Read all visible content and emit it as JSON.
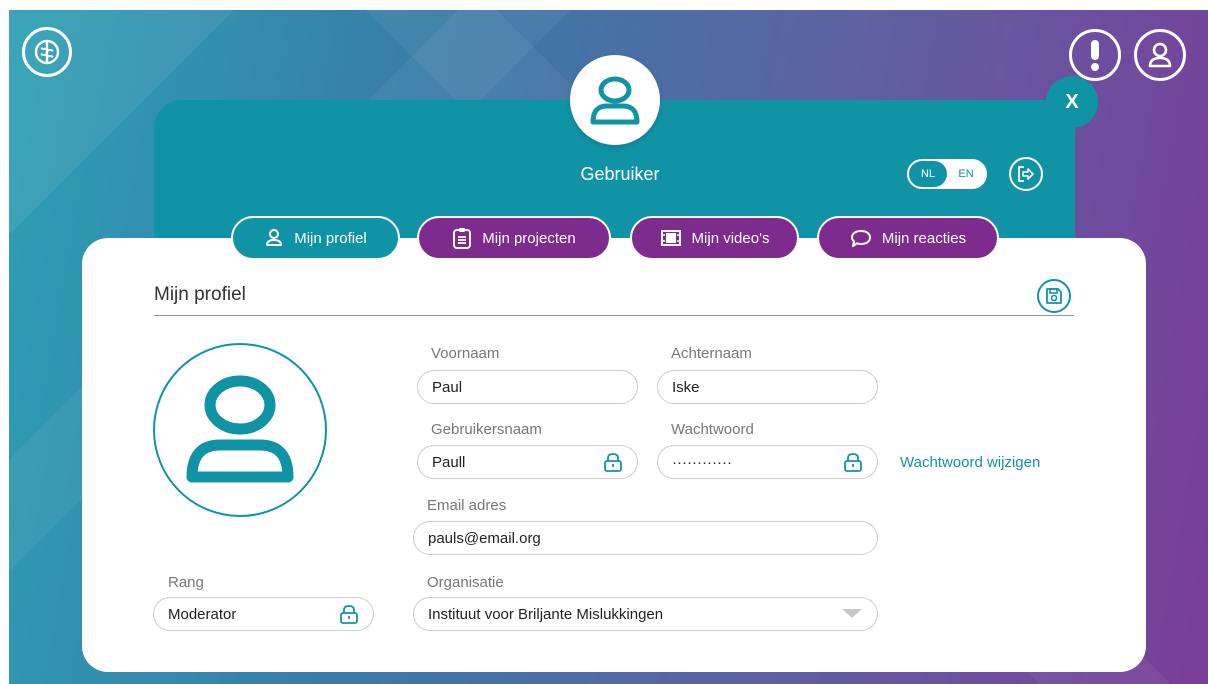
{
  "header": {
    "title": "Gebruiker",
    "close_label": "X",
    "lang_options": [
      "NL",
      "EN"
    ],
    "lang_selected": "NL"
  },
  "icons": {
    "top_left": "brain-icon",
    "alert": "exclamation-icon",
    "account": "user-icon",
    "logout": "logout-icon",
    "save": "save-icon",
    "lock": "lock-icon"
  },
  "tabs": [
    {
      "label": "Mijn profiel",
      "icon": "user-icon",
      "active": true
    },
    {
      "label": "Mijn projecten",
      "icon": "clipboard-icon",
      "active": false
    },
    {
      "label": "Mijn video's",
      "icon": "film-icon",
      "active": false
    },
    {
      "label": "Mijn reacties",
      "icon": "comment-icon",
      "active": false
    }
  ],
  "profile": {
    "section_title": "Mijn profiel",
    "first_name_label": "Voornaam",
    "first_name": "Paul",
    "last_name_label": "Achternaam",
    "last_name": "Iske",
    "username_label": "Gebruikersnaam",
    "username": "Paull",
    "password_label": "Wachtwoord",
    "password_mask": "············",
    "change_password": "Wachtwoord wijzigen",
    "email_label": "Email adres",
    "email": "pauls@email.org",
    "rank_label": "Rang",
    "rank": "Moderator",
    "organisation_label": "Organisatie",
    "organisation": "Instituut voor Briljante Mislukkingen"
  },
  "colors": {
    "teal": "#1193a6",
    "purple": "#7d2c8e"
  }
}
